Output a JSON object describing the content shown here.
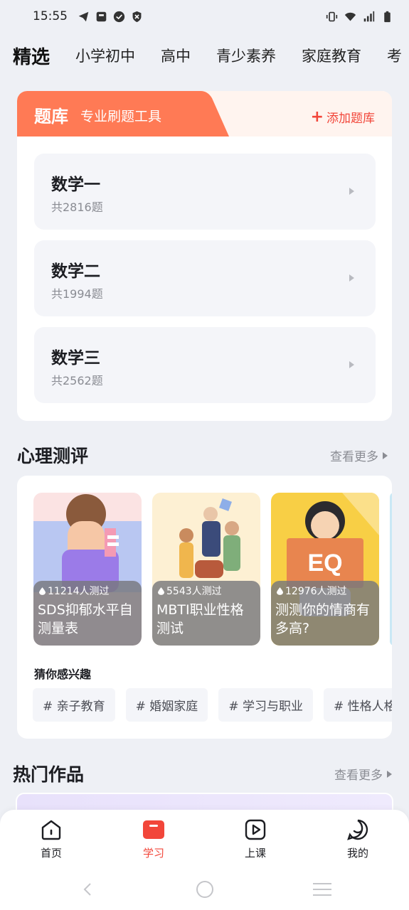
{
  "status": {
    "time": "15:55",
    "left_icons": [
      "telegram-icon",
      "mail-icon",
      "check-circle-icon",
      "shield-icon"
    ],
    "right_icons": [
      "vibrate-icon",
      "wifi-icon",
      "signal-icon",
      "battery-icon"
    ]
  },
  "top_tabs": [
    {
      "label": "精选",
      "active": true
    },
    {
      "label": "小学初中"
    },
    {
      "label": "高中"
    },
    {
      "label": "青少素养"
    },
    {
      "label": "家庭教育"
    },
    {
      "label": "考"
    }
  ],
  "bank": {
    "title": "题库",
    "subtitle": "专业刷题工具",
    "add_label": "添加题库",
    "items": [
      {
        "name": "数学一",
        "count": "共2816题"
      },
      {
        "name": "数学二",
        "count": "共1994题"
      },
      {
        "name": "数学三",
        "count": "共2562题"
      }
    ]
  },
  "psych": {
    "title": "心理测评",
    "more": "查看更多",
    "tests": [
      {
        "count": "11214人测过",
        "title": "SDS抑郁水平自测量表"
      },
      {
        "count": "5543人测过",
        "title": "MBTI职业性格测试"
      },
      {
        "count": "12976人测过",
        "title": "测测你的情商有多高?"
      }
    ],
    "interest_label": "猜你感兴趣",
    "tags": [
      "# 亲子教育",
      "# 婚姻家庭",
      "# 学习与职业",
      "# 性格人格"
    ],
    "eq_badge": "EQ"
  },
  "hot": {
    "title": "热门作品",
    "more": "查看更多"
  },
  "nav": {
    "items": [
      {
        "label": "首页",
        "icon": "home-icon"
      },
      {
        "label": "学习",
        "icon": "study-icon",
        "active": true
      },
      {
        "label": "上课",
        "icon": "play-icon"
      },
      {
        "label": "我的",
        "icon": "profile-icon"
      }
    ]
  },
  "colors": {
    "accent": "#f2463a",
    "bank_header": "#ff7a55",
    "page_bg": "#eef0f5"
  }
}
